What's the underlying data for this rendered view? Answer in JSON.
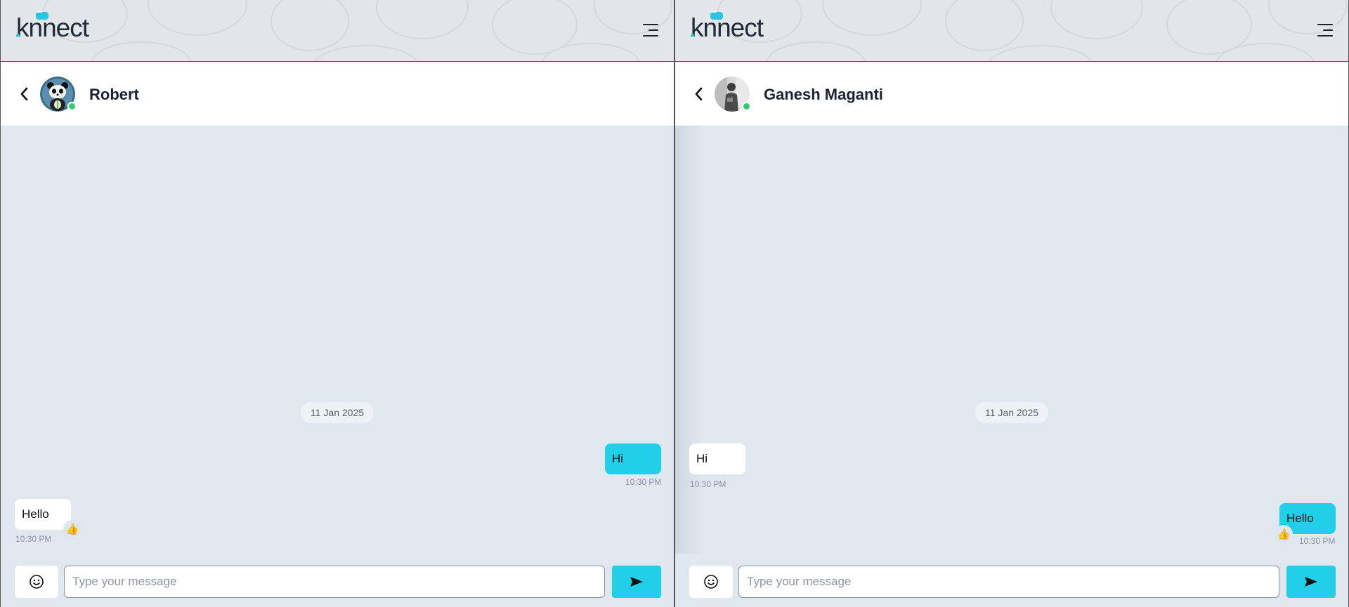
{
  "brand": {
    "logo_text": "knnect",
    "accent": "#22cfe9",
    "online_color": "#2ecc71"
  },
  "panes": [
    {
      "contact": {
        "name": "Robert",
        "avatar": "panda-avatar",
        "status": "online"
      },
      "date_separator": "11 Jan 2025",
      "messages": [
        {
          "direction": "outgoing",
          "text": "Hi",
          "time": "10:30 PM"
        },
        {
          "direction": "incoming",
          "text": "Hello",
          "time": "10:30 PM",
          "reaction": "👍"
        }
      ],
      "composer": {
        "placeholder": "Type your message",
        "value": ""
      }
    },
    {
      "contact": {
        "name": "Ganesh Maganti",
        "avatar": "person-photo-avatar",
        "status": "online"
      },
      "date_separator": "11 Jan 2025",
      "messages": [
        {
          "direction": "incoming",
          "text": "Hi",
          "time": "10:30 PM"
        },
        {
          "direction": "outgoing",
          "text": "Hello",
          "time": "10:30 PM",
          "reaction": "👍"
        }
      ],
      "composer": {
        "placeholder": "Type your message",
        "value": ""
      }
    }
  ]
}
